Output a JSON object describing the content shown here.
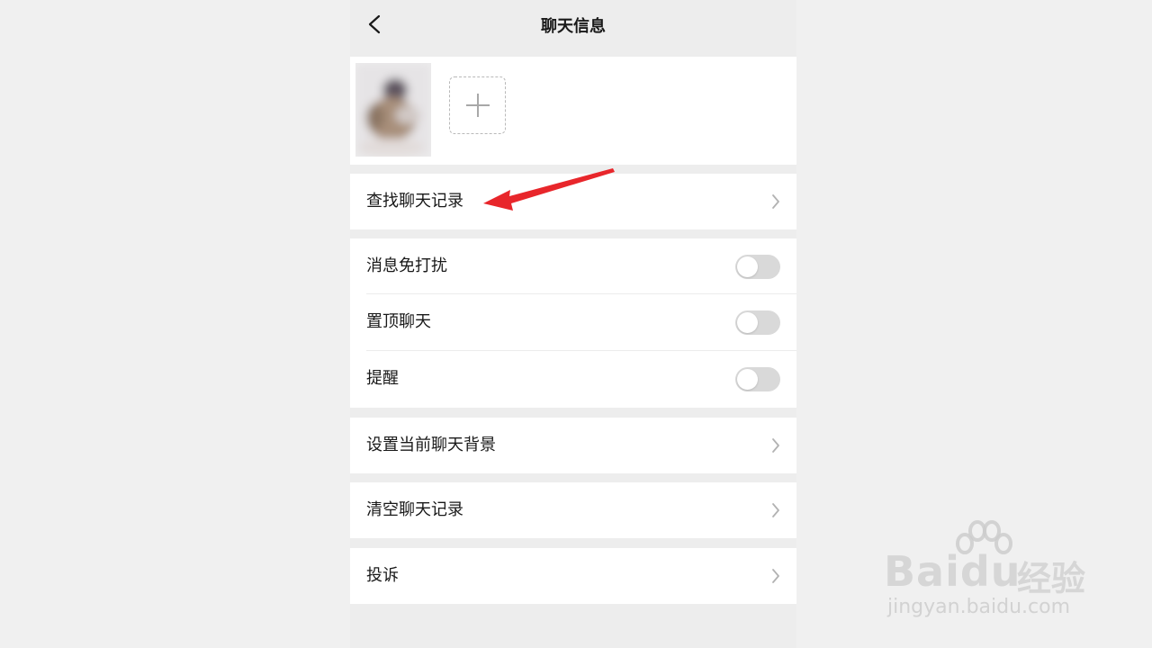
{
  "navbar": {
    "title": "聊天信息",
    "back_icon": "chevron-left-icon"
  },
  "members": {
    "add_icon": "plus-icon"
  },
  "rows": {
    "search_history": {
      "label": "查找聊天记录"
    },
    "mute": {
      "label": "消息免打扰",
      "on": false
    },
    "pin": {
      "label": "置顶聊天",
      "on": false
    },
    "remind": {
      "label": "提醒",
      "on": false
    },
    "background": {
      "label": "设置当前聊天背景"
    },
    "clear_history": {
      "label": "清空聊天记录"
    },
    "report": {
      "label": "投诉"
    }
  },
  "colors": {
    "page_bg": "#ededed",
    "row_bg": "#ffffff",
    "text": "#191919",
    "toggle_off": "#d9d9d9",
    "annotation_arrow": "#e8262b"
  },
  "watermark": {
    "brand": "Bai",
    "brand_suffix": "du",
    "product": "经验",
    "url": "jingyan.baidu.com"
  }
}
